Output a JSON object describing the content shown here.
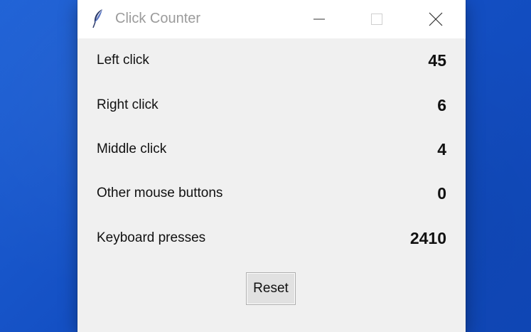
{
  "window": {
    "title": "Click Counter"
  },
  "titlebar": {
    "icons": [
      "feather-icon",
      "minimize-icon",
      "maximize-icon",
      "close-icon"
    ]
  },
  "counters": [
    {
      "label": "Left click",
      "value": "45"
    },
    {
      "label": "Right click",
      "value": "6"
    },
    {
      "label": "Middle click",
      "value": "4"
    },
    {
      "label": "Other mouse buttons",
      "value": "0"
    },
    {
      "label": "Keyboard presses",
      "value": "2410"
    }
  ],
  "actions": {
    "reset_label": "Reset"
  },
  "colors": {
    "desktop": "#1450c4",
    "window_bg": "#f0f0f0",
    "titlebar_bg": "#ffffff",
    "title_text": "#9b9b9b"
  }
}
